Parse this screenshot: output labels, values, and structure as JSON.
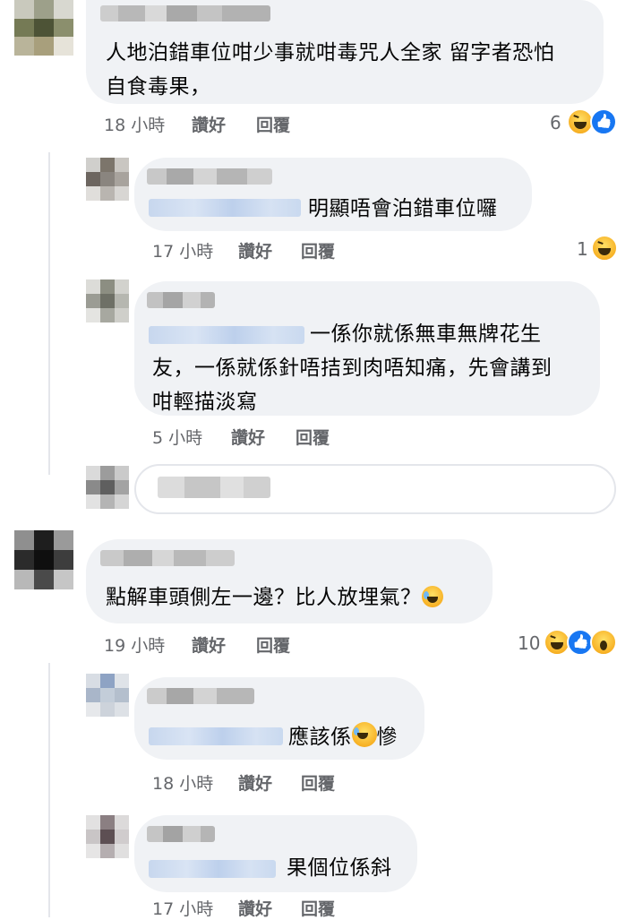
{
  "comments": [
    {
      "text": "人地泊錯車位咁少事就咁毒咒人全家 留字者恐怕自食毒果，",
      "line1": "人地泊錯車位咁少事就咁毒咒人全家 留字者恐怕",
      "line2": "自食毒果，",
      "time": "18 小時",
      "like": "讚好",
      "reply": "回覆",
      "reaction_count": "6",
      "reactions": [
        "haha-icon",
        "like-icon"
      ]
    },
    {
      "text": "明顯唔會泊錯車位囉",
      "time": "17 小時",
      "like": "讚好",
      "reply": "回覆",
      "reaction_count": "1",
      "reactions": [
        "haha-icon"
      ]
    },
    {
      "line1": "一係你就係無車無牌花生",
      "line2": "友，一係就係針唔拮到肉唔知痛，先會講到",
      "line3": "咁輕描淡寫",
      "time": "5 小時",
      "like": "讚好",
      "reply": "回覆"
    },
    {
      "text": "點解車頭側左一邊？比人放埋氣？",
      "time": "19 小時",
      "like": "讚好",
      "reply": "回覆",
      "reaction_count": "10",
      "reactions": [
        "haha-icon",
        "like-icon",
        "wow-icon"
      ]
    },
    {
      "text_a": "應該係",
      "text_b": "慘",
      "time": "18 小時",
      "like": "讚好",
      "reply": "回覆"
    },
    {
      "text": "果個位係斜",
      "time": "17 小時",
      "like": "讚好",
      "reply": "回覆"
    }
  ],
  "colors": {
    "bubble": "#f0f2f5",
    "meta": "#65676b",
    "like_blue": "#1877f2",
    "haha_yellow": "#f7b125"
  }
}
